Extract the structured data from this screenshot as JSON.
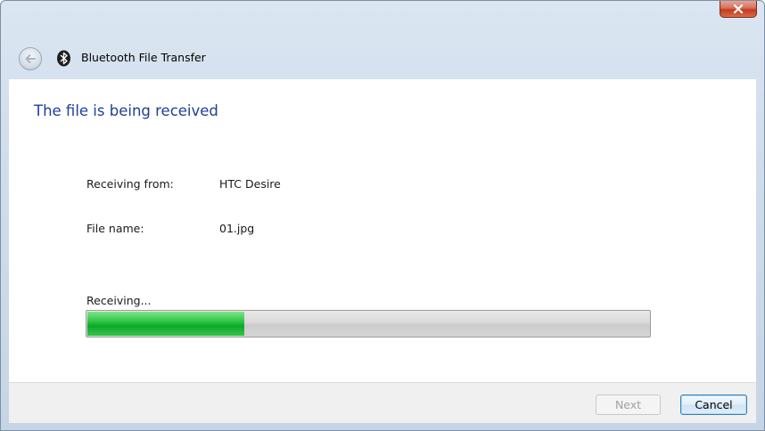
{
  "window": {
    "title": "Bluetooth File Transfer",
    "close_icon": "close-icon",
    "back_icon": "back-arrow-icon",
    "app_icon": "bluetooth-icon"
  },
  "main": {
    "heading": "The file is being received",
    "receiving_from_label": "Receiving from:",
    "receiving_from_value": "HTC Desire",
    "file_name_label": "File name:",
    "file_name_value": "01.jpg",
    "progress_label": "Receiving...",
    "progress_fraction": 0.28
  },
  "footer": {
    "next_label": "Next",
    "cancel_label": "Cancel"
  },
  "colors": {
    "heading": "#1e3f99",
    "progress_fill": "#22c03a",
    "close_button": "#c33a1f"
  }
}
